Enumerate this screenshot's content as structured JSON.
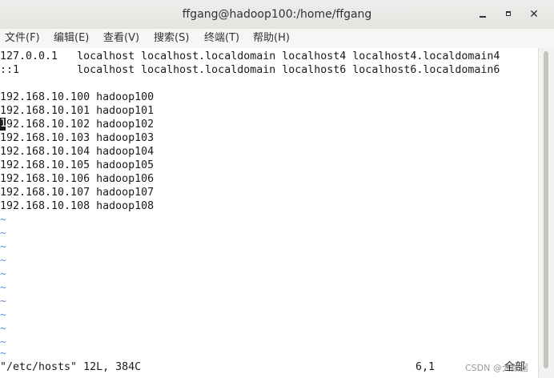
{
  "window": {
    "title": "ffgang@hadoop100:/home/ffgang",
    "controls": {
      "minimize": "minimize-icon",
      "maximize": "maximize-icon",
      "close_symbol": "✕"
    }
  },
  "menu": {
    "items": [
      {
        "label": "文件(F)"
      },
      {
        "label": "编辑(E)"
      },
      {
        "label": "查看(V)"
      },
      {
        "label": "搜索(S)"
      },
      {
        "label": "终端(T)"
      },
      {
        "label": "帮助(H)"
      }
    ]
  },
  "editor": {
    "lines": [
      "127.0.0.1   localhost localhost.localdomain localhost4 localhost4.localdomain4",
      "::1         localhost localhost.localdomain localhost6 localhost6.localdomain6",
      "",
      "192.168.10.100 hadoop100",
      "192.168.10.101 hadoop101",
      "92.168.10.102 hadoop102",
      "192.168.10.103 hadoop103",
      "192.168.10.104 hadoop104",
      "192.168.10.105 hadoop105",
      "192.168.10.106 hadoop106",
      "192.168.10.107 hadoop107",
      "192.168.10.108 hadoop108"
    ],
    "cursor_char": "1",
    "empty_line_marker": "~",
    "empty_lines_count": 11
  },
  "status": {
    "file_info": "\"/etc/hosts\" 12L, 384C",
    "position": "6,1",
    "scroll": "全部"
  },
  "watermark": {
    "text": "CSDN @大数据"
  },
  "colors": {
    "tilde": "#5a8bd6",
    "text": "#1a1a1a",
    "titlebar": "#e8e8e5",
    "menubar": "#f6f6f4"
  }
}
